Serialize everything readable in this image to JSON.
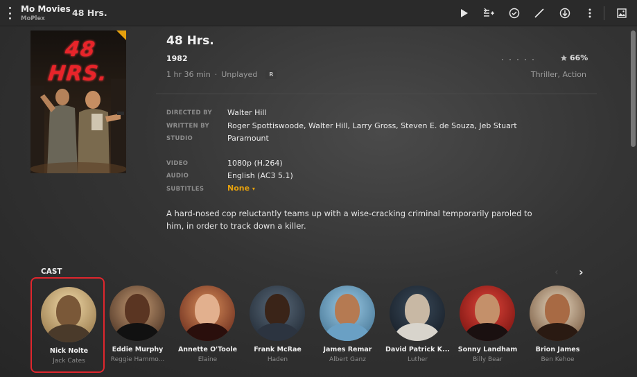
{
  "topbar": {
    "library_title": "Mo Movies",
    "server_name": "MoPlex",
    "page_title": "48 Hrs.",
    "actions": [
      "play-icon",
      "add-to-queue-icon",
      "mark-played-icon",
      "edit-icon",
      "download-icon",
      "more-options-icon",
      "artwork-icon"
    ]
  },
  "poster": {
    "title_text": "48 HRS."
  },
  "movie": {
    "title": "48 Hrs.",
    "year": "1982",
    "duration": "1 hr 36 min",
    "status": "Unplayed",
    "content_rating": "R",
    "critic_rating": "66%",
    "genres": "Thriller, Action",
    "summary": "A hard-nosed cop reluctantly teams up with a wise-cracking criminal temporarily paroled to him, in order to track down a killer."
  },
  "details": {
    "directed_by_label": "DIRECTED BY",
    "directed_by": "Walter Hill",
    "written_by_label": "WRITTEN BY",
    "written_by": "Roger Spottiswoode, Walter Hill, Larry Gross, Steven E. de Souza, Jeb Stuart",
    "studio_label": "STUDIO",
    "studio": "Paramount",
    "video_label": "VIDEO",
    "video": "1080p (H.264)",
    "audio_label": "AUDIO",
    "audio": "English (AC3 5.1)",
    "subtitles_label": "SUBTITLES",
    "subtitles": "None"
  },
  "cast": {
    "title": "CAST",
    "members": [
      {
        "name": "Nick Nolte",
        "role": "Jack Cates"
      },
      {
        "name": "Eddie Murphy",
        "role": "Reggie Hammo..."
      },
      {
        "name": "Annette O'Toole",
        "role": "Elaine"
      },
      {
        "name": "Frank McRae",
        "role": "Haden"
      },
      {
        "name": "James Remar",
        "role": "Albert Ganz"
      },
      {
        "name": "David Patrick K...",
        "role": "Luther"
      },
      {
        "name": "Sonny Landham",
        "role": "Billy Bear"
      },
      {
        "name": "Brion James",
        "role": "Ben Kehoe"
      }
    ]
  },
  "colors": {
    "accent": "#e5a00d",
    "selection": "#e0262d"
  }
}
